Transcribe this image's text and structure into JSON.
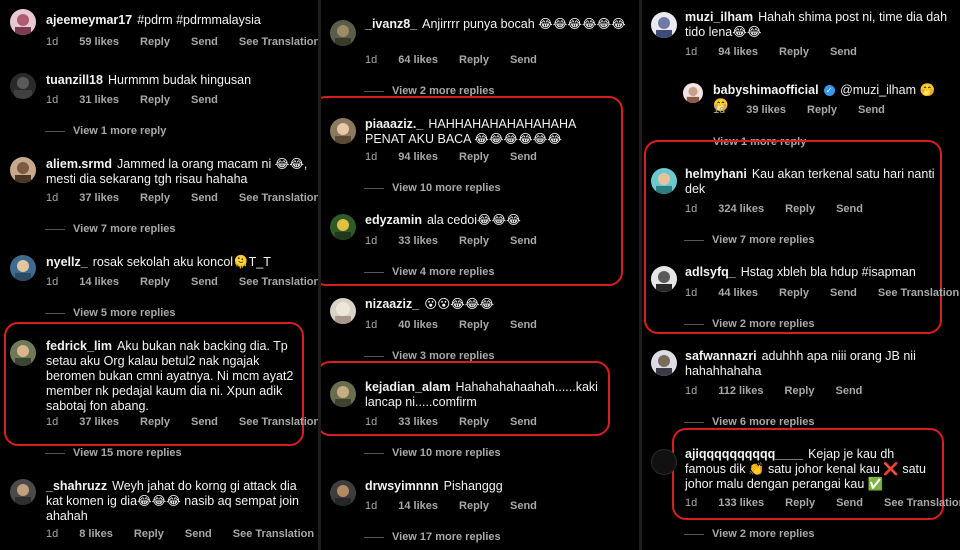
{
  "col1": [
    {
      "user": "ajeemeymar17",
      "text": "#pdrm #pdrmmalaysia",
      "time": "1d",
      "likes": "59 likes",
      "reply": "Reply",
      "send": "Send",
      "translate": "See Translation"
    },
    {
      "user": "tuanzill18",
      "text": "Hurmmm budak hingusan",
      "time": "1d",
      "likes": "31 likes",
      "reply": "Reply",
      "send": "Send",
      "view": "View 1 more reply"
    },
    {
      "user": "aliem.srmd",
      "text": "Jammed la orang macam ni 😂😂, mesti dia sekarang tgh risau hahaha",
      "time": "1d",
      "likes": "37 likes",
      "reply": "Reply",
      "send": "Send",
      "translate": "See Translation",
      "view": "View 7 more replies"
    },
    {
      "user": "nyellz_",
      "text": "rosak sekolah aku koncol🫠T_T",
      "time": "1d",
      "likes": "14 likes",
      "reply": "Reply",
      "send": "Send",
      "translate": "See Translation",
      "view": "View 5 more replies"
    },
    {
      "user": "fedrick_lim",
      "text": "Aku bukan nak backing dia. Tp setau aku Org kalau betul2 nak ngajak beromen bukan cmni ayatnya. Ni mcm ayat2 member nk pedajal kaum dia ni. Xpun adik sabotaj fon abang.",
      "time": "1d",
      "likes": "37 likes",
      "reply": "Reply",
      "send": "Send",
      "translate": "See Translation",
      "view": "View 15 more replies"
    },
    {
      "user": "_shahruzz",
      "text": "Weyh jahat do korng gi attack dia kat komen ig dia😂😂😂 nasib aq sempat join ahahah",
      "time": "1d",
      "likes": "8 likes",
      "reply": "Reply",
      "send": "Send",
      "translate": "See Translation"
    }
  ],
  "col2": [
    {
      "user": "_ivanz8_",
      "text": "Anjirrrr punya bocah 😂😂😂😂😂😂",
      "time": "1d",
      "likes": "64 likes",
      "reply": "Reply",
      "send": "Send",
      "view": "View 2 more replies"
    },
    {
      "user": "piaaaziz._",
      "text": "HAHHAHAHAHAHAHAHA PENAT AKU BACA 😂😂😂😂😂😂",
      "time": "1d",
      "likes": "94 likes",
      "reply": "Reply",
      "send": "Send",
      "view": "View 10 more replies"
    },
    {
      "user": "edyzamin",
      "text": "ala cedoi😂😂😂",
      "time": "1d",
      "likes": "33 likes",
      "reply": "Reply",
      "send": "Send",
      "view": "View 4 more replies"
    },
    {
      "user": "nizaaziz_",
      "text": "😮😮😂😂😂",
      "time": "1d",
      "likes": "40 likes",
      "reply": "Reply",
      "send": "Send",
      "view": "View 3 more replies"
    },
    {
      "user": "kejadian_alam",
      "text": "Hahahahahaahah......kaki lancap ni.....comfirm",
      "time": "1d",
      "likes": "33 likes",
      "reply": "Reply",
      "send": "Send",
      "view": "View 10 more replies"
    },
    {
      "user": "drwsyimnnn",
      "text": "Pishanggg",
      "time": "1d",
      "likes": "14 likes",
      "reply": "Reply",
      "send": "Send",
      "view": "View 17 more replies"
    }
  ],
  "col3": [
    {
      "user": "muzi_ilham",
      "text": "Hahah shima post ni, time dia dah tido lena😂😂",
      "time": "1d",
      "likes": "94 likes",
      "reply": "Reply",
      "send": "Send"
    },
    {
      "user": "babyshimaofficial",
      "text": "@muzi_ilham 🤭🤭",
      "time": "1d",
      "likes": "39 likes",
      "reply": "Reply",
      "send": "Send",
      "view": "View 1 more reply"
    },
    {
      "user": "helmyhani",
      "text": "Kau akan terkenal satu hari nanti dek",
      "time": "1d",
      "likes": "324 likes",
      "reply": "Reply",
      "send": "Send",
      "view": "View 7 more replies"
    },
    {
      "user": "adlsyfq_",
      "text": "Hstag xbleh bla hdup #isapman",
      "time": "1d",
      "likes": "44 likes",
      "reply": "Reply",
      "send": "Send",
      "translate": "See Translation",
      "view": "View 2 more replies"
    },
    {
      "user": "safwannazri",
      "text": "aduhhh apa niii orang JB nii hahahhahaha",
      "time": "1d",
      "likes": "112 likes",
      "reply": "Reply",
      "send": "Send",
      "view": "View 6 more replies"
    },
    {
      "user": "ajiqqqqqqqqqq____",
      "text": "Kejap je kau dh famous dik 👏 satu johor kenal kau ❌ satu johor malu dengan perangai kau ✅",
      "time": "1d",
      "likes": "133 likes",
      "reply": "Reply",
      "send": "Send",
      "translate": "See Translation",
      "view": "View 2 more replies"
    }
  ],
  "colors": {
    "highlight": "#d91e1e",
    "verified": "#3897f0",
    "meta": "#a8a8a8"
  }
}
